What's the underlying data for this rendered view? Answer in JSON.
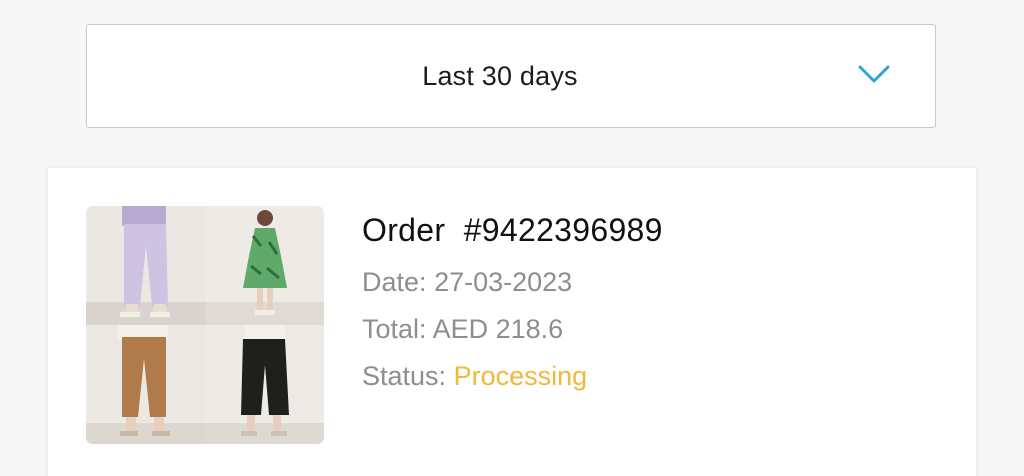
{
  "filter": {
    "selected": "Last 30 days",
    "icon": "chevron-down-icon",
    "icon_color": "#2aa5d6"
  },
  "order": {
    "title_prefix": "Order",
    "number": "#9422396989",
    "date_label": "Date:",
    "date": "27-03-2023",
    "total_label": "Total:",
    "total": "AED 218.6",
    "status_label": "Status:",
    "status": "Processing",
    "status_color": "#f2b73c",
    "products": [
      {
        "name": "lavender-trousers-image"
      },
      {
        "name": "green-floral-dress-image"
      },
      {
        "name": "tan-trousers-image"
      },
      {
        "name": "black-culottes-image"
      }
    ]
  }
}
